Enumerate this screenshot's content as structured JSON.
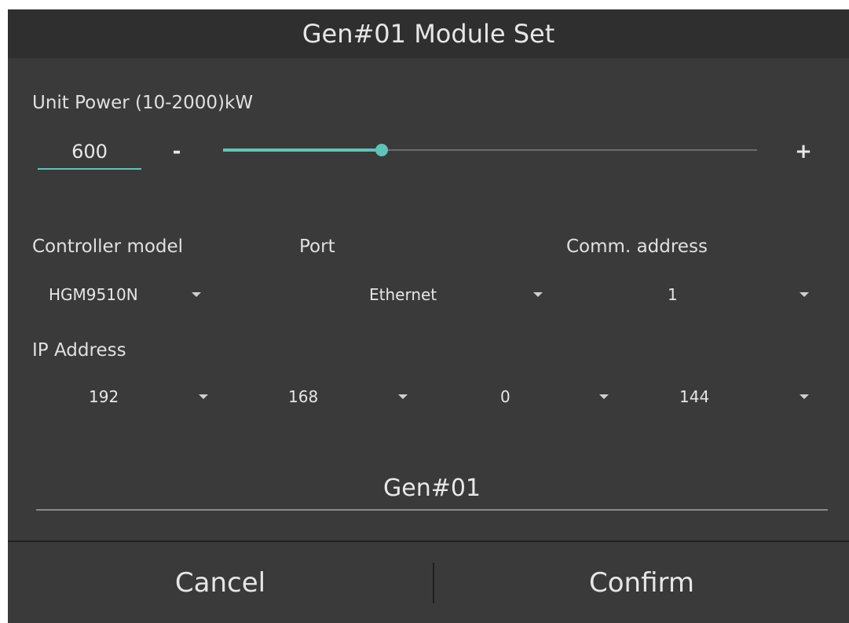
{
  "dialog": {
    "title": "Gen#01 Module Set"
  },
  "power": {
    "label": "Unit Power (10-2000)kW",
    "value": "600",
    "min": 10,
    "max": 2000,
    "slider_value": 600,
    "minus_label": "-",
    "plus_label": "+"
  },
  "settings": {
    "controller_label": "Controller model",
    "port_label": "Port",
    "comm_label": "Comm. address",
    "controller_value": "HGM9510N",
    "port_value": "Ethernet",
    "comm_value": "1"
  },
  "ip": {
    "label": "IP Address",
    "octets": [
      "192",
      "168",
      "0",
      "144"
    ]
  },
  "name_field": {
    "value": "Gen#01"
  },
  "footer": {
    "cancel_label": "Cancel",
    "confirm_label": "Confirm"
  },
  "colors": {
    "accent": "#5fc4b8",
    "dialog_bg": "#3a3a3a",
    "title_bg": "#2f2f2f"
  },
  "icons": {
    "dropdown_caret": "chevron-down-icon"
  }
}
